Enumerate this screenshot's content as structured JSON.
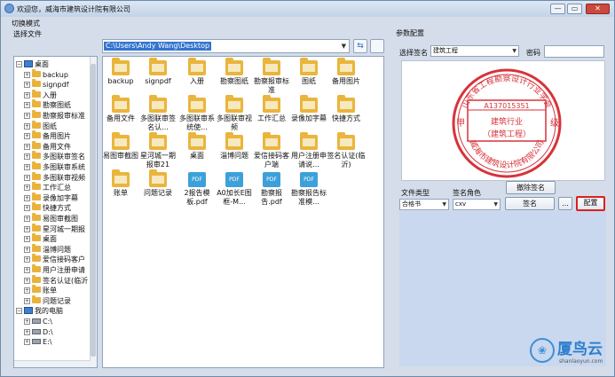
{
  "window": {
    "title": "欢迎您，威海市建筑设计院有限公司",
    "minimize": "—",
    "maximize": "▭",
    "close": "✕"
  },
  "menu": {
    "switch_mode": "切换模式"
  },
  "left": {
    "select_file_label": "选择文件",
    "path_value": "C:\\Users\\Andy Wang\\Desktop",
    "refresh_symbol": "⇆"
  },
  "tree": [
    {
      "label": "桌面",
      "kind": "pc",
      "indent": 0,
      "expander": "−"
    },
    {
      "label": "backup",
      "kind": "folder",
      "indent": 1,
      "expander": "+"
    },
    {
      "label": "signpdf",
      "kind": "folder",
      "indent": 1,
      "expander": "+"
    },
    {
      "label": "入册",
      "kind": "folder",
      "indent": 1,
      "expander": "+"
    },
    {
      "label": "勘察图纸",
      "kind": "folder",
      "indent": 1,
      "expander": "+"
    },
    {
      "label": "勘察报审标准",
      "kind": "folder",
      "indent": 1,
      "expander": "+"
    },
    {
      "label": "图纸",
      "kind": "folder",
      "indent": 1,
      "expander": "+"
    },
    {
      "label": "备用图片",
      "kind": "folder",
      "indent": 1,
      "expander": "+"
    },
    {
      "label": "备用文件",
      "kind": "folder",
      "indent": 1,
      "expander": "+"
    },
    {
      "label": "多图联审签名",
      "kind": "folder",
      "indent": 1,
      "expander": "+"
    },
    {
      "label": "多图联审系统",
      "kind": "folder",
      "indent": 1,
      "expander": "+"
    },
    {
      "label": "多图联审视频",
      "kind": "folder",
      "indent": 1,
      "expander": "+"
    },
    {
      "label": "工作汇总",
      "kind": "folder",
      "indent": 1,
      "expander": "+"
    },
    {
      "label": "录像加字幕",
      "kind": "folder",
      "indent": 1,
      "expander": "+"
    },
    {
      "label": "快捷方式",
      "kind": "folder",
      "indent": 1,
      "expander": "+"
    },
    {
      "label": "易图审截图",
      "kind": "folder",
      "indent": 1,
      "expander": "+"
    },
    {
      "label": "星河城一期报",
      "kind": "folder",
      "indent": 1,
      "expander": "+"
    },
    {
      "label": "桌面",
      "kind": "folder",
      "indent": 1,
      "expander": "+"
    },
    {
      "label": "淄博问题",
      "kind": "folder",
      "indent": 1,
      "expander": "+"
    },
    {
      "label": "爱信接码客户",
      "kind": "folder",
      "indent": 1,
      "expander": "+"
    },
    {
      "label": "用户注册申请",
      "kind": "folder",
      "indent": 1,
      "expander": "+"
    },
    {
      "label": "签名认证(临沂",
      "kind": "folder",
      "indent": 1,
      "expander": "+"
    },
    {
      "label": "账单",
      "kind": "folder",
      "indent": 1,
      "expander": "+"
    },
    {
      "label": "问题记录",
      "kind": "folder",
      "indent": 1,
      "expander": "+"
    },
    {
      "label": "我的电脑",
      "kind": "pc",
      "indent": 0,
      "expander": "−"
    },
    {
      "label": "C:\\",
      "kind": "drive",
      "indent": 1,
      "expander": "+"
    },
    {
      "label": "D:\\",
      "kind": "drive",
      "indent": 1,
      "expander": "+"
    },
    {
      "label": "E:\\",
      "kind": "drive",
      "indent": 1,
      "expander": "+"
    }
  ],
  "files": [
    {
      "label": "backup",
      "kind": "folder"
    },
    {
      "label": "signpdf",
      "kind": "folder"
    },
    {
      "label": "入册",
      "kind": "folder"
    },
    {
      "label": "勘察图纸",
      "kind": "folder"
    },
    {
      "label": "勘察报审标准",
      "kind": "folder"
    },
    {
      "label": "图纸",
      "kind": "folder"
    },
    {
      "label": "备用图片",
      "kind": "folder"
    },
    {
      "label": "备用文件",
      "kind": "folder"
    },
    {
      "label": "多图联审签名认...",
      "kind": "folder"
    },
    {
      "label": "多图联审系统使...",
      "kind": "folder"
    },
    {
      "label": "多图联审视频",
      "kind": "folder"
    },
    {
      "label": "工作汇总",
      "kind": "folder"
    },
    {
      "label": "录像加字幕",
      "kind": "folder"
    },
    {
      "label": "快捷方式",
      "kind": "folder"
    },
    {
      "label": "易图审截图",
      "kind": "folder"
    },
    {
      "label": "星河城一期报审21",
      "kind": "folder"
    },
    {
      "label": "桌面",
      "kind": "folder"
    },
    {
      "label": "淄博问题",
      "kind": "folder"
    },
    {
      "label": "爱信接码客户端",
      "kind": "folder"
    },
    {
      "label": "用户注册申请说...",
      "kind": "folder"
    },
    {
      "label": "签名认证(临沂)",
      "kind": "folder"
    },
    {
      "label": "账单",
      "kind": "folder"
    },
    {
      "label": "问题记录",
      "kind": "folder"
    },
    {
      "label": "2报告模板.pdf",
      "kind": "pdf"
    },
    {
      "label": "A0加长E图框-M...",
      "kind": "pdf"
    },
    {
      "label": "勘察报告.pdf",
      "kind": "pdf"
    },
    {
      "label": "勘察报告标准模...",
      "kind": "pdf"
    }
  ],
  "config": {
    "panel_label": "参数配置",
    "select_sign_label": "选择签名",
    "select_sign_value": "建筑工程",
    "password_label": "密码",
    "file_type_label": "文件类型",
    "file_type_value": "合格书",
    "sign_role_label": "签名角色",
    "sign_role_value": "cxv",
    "remove_sign_button": "撤除签名",
    "sign_button": "签名",
    "ellipsis_button": "...",
    "config_button": "配置",
    "highlight_color": "#e01d1d"
  },
  "stamp": {
    "company_arc": "山东省工程勘察设计行业学会",
    "code": "A137015351",
    "level_left": "甲",
    "level_right": "级",
    "industry": "建筑行业",
    "specialty": "（建筑工程）",
    "bottom_arc": "威海市建筑设计院有限公司",
    "color": "#d8323a"
  },
  "watermark": {
    "title": "厦鸟云",
    "url": "shanlaoyun.com"
  }
}
